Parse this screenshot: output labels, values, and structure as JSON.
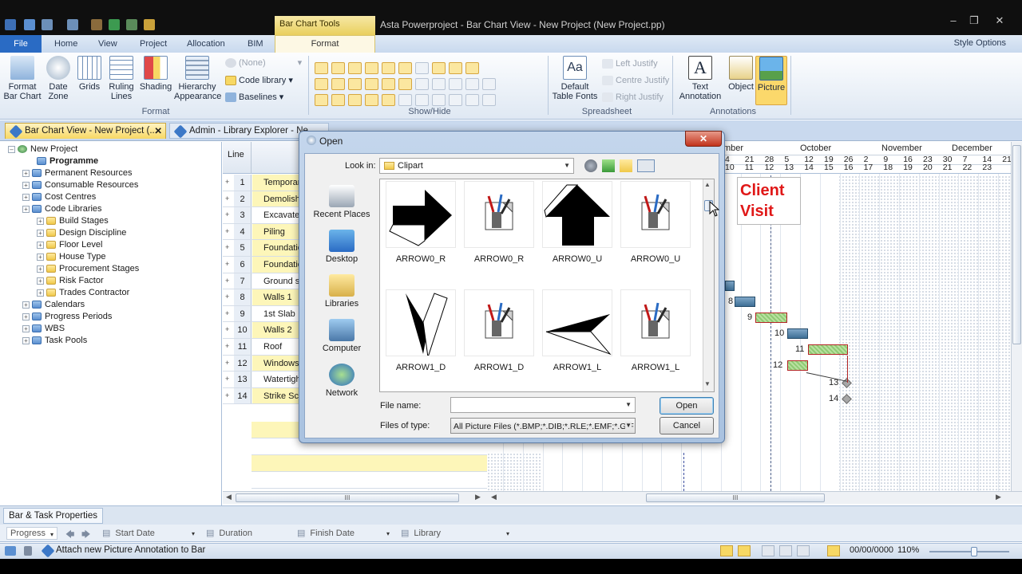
{
  "window": {
    "title": "Asta Powerproject - Bar Chart View - New Project (New Project.pp)",
    "context_tab_group": "Bar Chart Tools"
  },
  "ribbon_tabs": [
    {
      "label": "File"
    },
    {
      "label": "Home"
    },
    {
      "label": "View"
    },
    {
      "label": "Project"
    },
    {
      "label": "Allocation"
    },
    {
      "label": "BIM"
    },
    {
      "label": "Format"
    }
  ],
  "style_options": "Style Options",
  "ribbon": {
    "format_group": {
      "label": "Format",
      "buttons": [
        "Format\nBar Chart",
        "Date\nZone",
        "Grids",
        "Ruling\nLines",
        "Shading",
        "Hierarchy\nAppearance"
      ],
      "none_combo": "(None)",
      "code_library": "Code library",
      "baselines": "Baselines"
    },
    "showhide_group": {
      "label": "Show/Hide"
    },
    "spreadsheet_group": {
      "label": "Spreadsheet",
      "default_fonts": "Default\nTable Fonts",
      "left_justify": "Left Justify",
      "centre_justify": "Centre Justify",
      "right_justify": "Right Justify"
    },
    "annotations_group": {
      "label": "Annotations",
      "text": "Text\nAnnotation",
      "object": "Object",
      "picture": "Picture"
    }
  },
  "doc_tabs": [
    {
      "label": "Bar Chart View - New Project (..."
    },
    {
      "label": "Admin - Library Explorer - Ne..."
    }
  ],
  "tree": {
    "root": "New Project",
    "programme": "Programme",
    "nodes": [
      {
        "label": "Permanent Resources",
        "level": 1
      },
      {
        "label": "Consumable Resources",
        "level": 1
      },
      {
        "label": "Cost Centres",
        "level": 1
      },
      {
        "label": "Code Libraries",
        "level": 1
      },
      {
        "label": "Build Stages",
        "level": 2
      },
      {
        "label": "Design Discipline",
        "level": 2
      },
      {
        "label": "Floor Level",
        "level": 2
      },
      {
        "label": "House Type",
        "level": 2
      },
      {
        "label": "Procurement Stages",
        "level": 2
      },
      {
        "label": "Risk Factor",
        "level": 2
      },
      {
        "label": "Trades Contractor",
        "level": 2
      },
      {
        "label": "Calendars",
        "level": 1
      },
      {
        "label": "Progress Periods",
        "level": 1
      },
      {
        "label": "WBS",
        "level": 1
      },
      {
        "label": "Task Pools",
        "level": 1
      }
    ]
  },
  "grid": {
    "line_header": "Line",
    "rows": [
      {
        "num": "1",
        "name": "Temporar"
      },
      {
        "num": "2",
        "name": "Demolish"
      },
      {
        "num": "3",
        "name": "Excavate"
      },
      {
        "num": "4",
        "name": "Piling"
      },
      {
        "num": "5",
        "name": "Foundatio"
      },
      {
        "num": "6",
        "name": "Foundatio"
      },
      {
        "num": "7",
        "name": "Ground s"
      },
      {
        "num": "8",
        "name": "Walls 1"
      },
      {
        "num": "9",
        "name": "1st Slab"
      },
      {
        "num": "10",
        "name": "Walls 2"
      },
      {
        "num": "11",
        "name": "Roof"
      },
      {
        "num": "12",
        "name": "Windows"
      },
      {
        "num": "13",
        "name": "Watertigh"
      },
      {
        "num": "14",
        "name": "Strike Sca"
      }
    ]
  },
  "gantt": {
    "months": [
      "mber",
      "October",
      "November",
      "December"
    ],
    "days": [
      "4",
      "21",
      "28",
      "5",
      "12",
      "19",
      "26",
      "2",
      "9",
      "16",
      "23",
      "30",
      "7",
      "14",
      "21"
    ],
    "weeks": [
      "10",
      "11",
      "12",
      "13",
      "14",
      "15",
      "16",
      "17",
      "18",
      "19",
      "20",
      "21",
      "22",
      "23"
    ],
    "annotation": "Client\nVisit",
    "bar_labels": [
      "8",
      "9",
      "10",
      "11",
      "12",
      "13",
      "14"
    ]
  },
  "dialog": {
    "title": "Open",
    "look_in_label": "Look in:",
    "look_in_value": "Clipart",
    "places": [
      "Recent Places",
      "Desktop",
      "Libraries",
      "Computer",
      "Network"
    ],
    "files": [
      {
        "name": "ARROW0_R",
        "icon": "arrow-right-icon"
      },
      {
        "name": "ARROW0_R",
        "icon": "generic-image-file-icon"
      },
      {
        "name": "ARROW0_U",
        "icon": "arrow-up-icon"
      },
      {
        "name": "ARROW0_U",
        "icon": "generic-image-file-icon"
      },
      {
        "name": "ARROW1_D",
        "icon": "arrow-down-thin-icon"
      },
      {
        "name": "ARROW1_D",
        "icon": "generic-image-file-icon"
      },
      {
        "name": "ARROW1_L",
        "icon": "arrow-left-thin-icon"
      },
      {
        "name": "ARROW1_L",
        "icon": "generic-image-file-icon"
      }
    ],
    "file_name_label": "File name:",
    "file_name_value": "",
    "file_type_label": "Files of type:",
    "file_type_value": "All Picture Files (*.BMP;*.DIB;*.RLE;*.EMF;*.GIF",
    "open_button": "Open",
    "cancel_button": "Cancel"
  },
  "bottom": {
    "properties_tab": "Bar & Task Properties",
    "fields": [
      "Progress",
      "Start Date",
      "Duration",
      "Finish Date",
      "Library"
    ]
  },
  "status": {
    "message": "Attach new Picture Annotation to Bar",
    "date": "00/00/0000",
    "zoom": "110%"
  }
}
